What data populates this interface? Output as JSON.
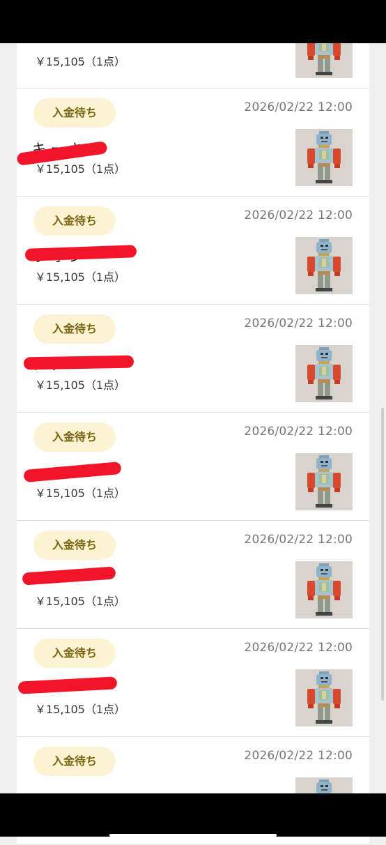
{
  "orders": [
    {
      "status": "",
      "date": "",
      "name": "",
      "price": "￥15,105（1点）"
    },
    {
      "status": "入金待ち",
      "date": "2026/02/22 12:00",
      "name": "キ ー キ",
      "price": "￥15,105（1点）"
    },
    {
      "status": "入金待ち",
      "date": "2026/02/22 12:00",
      "name": "ウ オ ン",
      "price": "￥15,105（1点）"
    },
    {
      "status": "入金待ち",
      "date": "2026/02/22 12:00",
      "name": "ア ア",
      "price": "￥15,105（1点）"
    },
    {
      "status": "入金待ち",
      "date": "2026/02/22 12:00",
      "name": "",
      "price": "￥15,105（1点）"
    },
    {
      "status": "入金待ち",
      "date": "2026/02/22 12:00",
      "name": "",
      "price": "￥15,105（1点）"
    },
    {
      "status": "入金待ち",
      "date": "2026/02/22 12:00",
      "name": "",
      "price": "￥15,105（1点）"
    },
    {
      "status": "入金待ち",
      "date": "2026/02/22 12:00",
      "name": "",
      "price": ""
    }
  ],
  "colors": {
    "badge_bg": "#fbf3d2",
    "badge_text": "#7a6410",
    "redaction": "#f2152a"
  },
  "thumbnail_icon": "robot-toy-icon"
}
